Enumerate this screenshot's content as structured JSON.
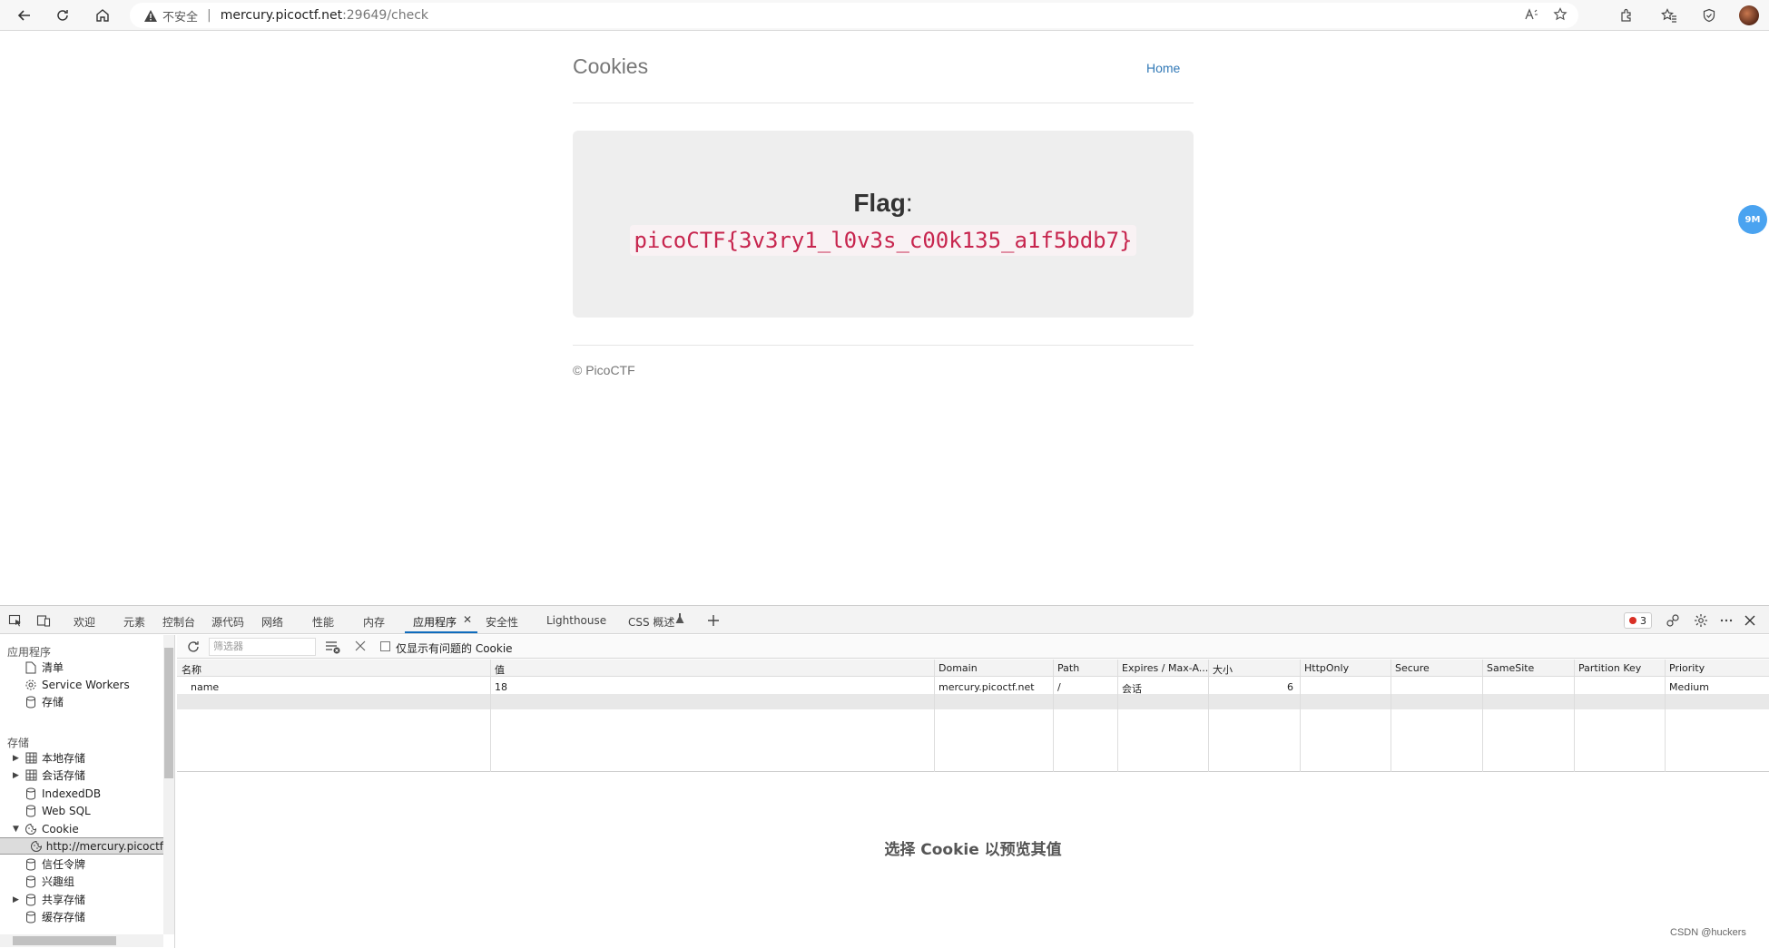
{
  "browser": {
    "insecure_label": "不安全",
    "url_host": "mercury.picoctf.net",
    "url_path": ":29649/check"
  },
  "site": {
    "title": "Cookies",
    "nav_home": "Home",
    "flag_label": "Flag",
    "flag_colon": ":",
    "flag_value": "picoCTF{3v3ry1_l0v3s_c00k135_a1f5bdb7}",
    "footer": "© PicoCTF",
    "float_badge": "9M"
  },
  "devtools": {
    "tabs": [
      "欢迎",
      "元素",
      "控制台",
      "源代码",
      "网络",
      "性能",
      "内存",
      "应用程序",
      "安全性",
      "Lighthouse",
      "CSS 概述"
    ],
    "active_tab": "应用程序",
    "error_count": "3",
    "sidebar": {
      "section_app": "应用程序",
      "app_items": [
        "清单",
        "Service Workers",
        "存储"
      ],
      "section_storage": "存储",
      "storage_items": [
        "本地存储",
        "会话存储",
        "IndexedDB",
        "Web SQL",
        "Cookie",
        "http://mercury.picoctf",
        "信任令牌",
        "兴趣组",
        "共享存储",
        "缓存存储"
      ]
    },
    "toolbar": {
      "filter_placeholder": "筛选器",
      "only_issues_label": "仅显示有问题的 Cookie"
    },
    "columns": [
      "名称",
      "值",
      "Domain",
      "Path",
      "Expires / Max-A...",
      "大小",
      "HttpOnly",
      "Secure",
      "SameSite",
      "Partition Key",
      "Priority"
    ],
    "rows": [
      {
        "name": "name",
        "value": "18",
        "domain": "mercury.picoctf.net",
        "path": "/",
        "expires": "会话",
        "size": "6",
        "httponly": "",
        "secure": "",
        "samesite": "",
        "partition_key": "",
        "priority": "Medium"
      }
    ],
    "preview_hint": "选择 Cookie 以预览其值"
  },
  "watermark": "CSDN @huckers"
}
